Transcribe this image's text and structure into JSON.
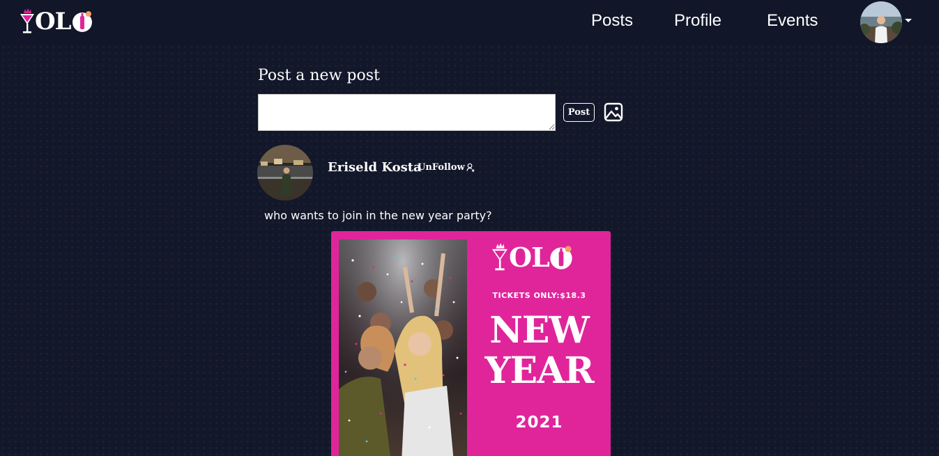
{
  "brand": {
    "logo_text": "OL",
    "accent_color": "#e0259b"
  },
  "nav": {
    "items": [
      {
        "label": "Posts",
        "icon": null
      },
      {
        "label": "Profile",
        "icon": null
      },
      {
        "label": "Events",
        "icon": null
      }
    ],
    "avatar_icon": "user-avatar",
    "dropdown_icon": "caret-down-icon"
  },
  "composer": {
    "title": "Post a new post",
    "input_value": "",
    "post_label": "Post",
    "image_icon": "image-icon"
  },
  "post": {
    "author": "Eriseld Kosta",
    "unfollow_label": "UnFollow",
    "unfollow_icon": "user-remove-icon",
    "text": "who wants to join in the new year party?",
    "flyer": {
      "logo_text": "OL",
      "tickets": "TICKETS ONLY:$18.3",
      "headline_line1": "NEW",
      "headline_line2": "YEAR",
      "year": "2021",
      "background_color": "#e0259b"
    }
  }
}
